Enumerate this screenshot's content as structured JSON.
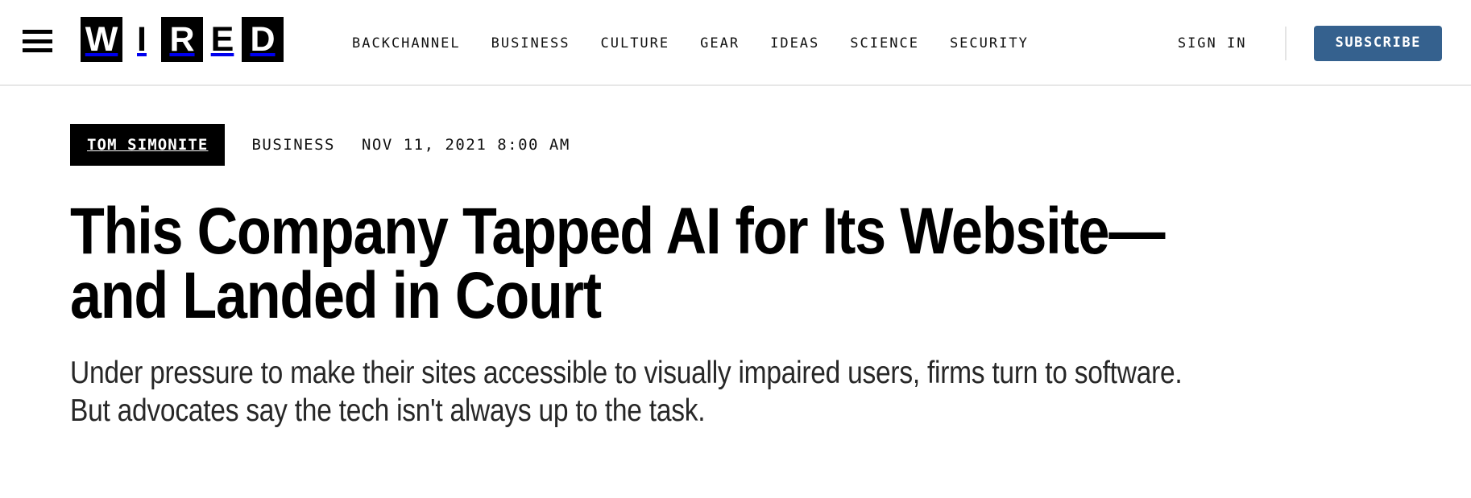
{
  "header": {
    "menu_icon": "hamburger-menu-icon",
    "logo": {
      "name": "WIRED",
      "letters": [
        {
          "char": "W",
          "inverted": true
        },
        {
          "char": "I",
          "inverted": false
        },
        {
          "char": "R",
          "inverted": true
        },
        {
          "char": "E",
          "inverted": false
        },
        {
          "char": "D",
          "inverted": true
        }
      ]
    },
    "nav_links": [
      {
        "label": "BACKCHANNEL"
      },
      {
        "label": "BUSINESS"
      },
      {
        "label": "CULTURE"
      },
      {
        "label": "GEAR"
      },
      {
        "label": "IDEAS"
      },
      {
        "label": "SCIENCE"
      },
      {
        "label": "SECURITY"
      }
    ],
    "sign_in_label": "SIGN IN",
    "subscribe_label": "SUBSCRIBE",
    "subscribe_color": "#35618e",
    "divider_color": "#e4e4e4",
    "border_color": "#e7e7e7"
  },
  "article": {
    "author": "TOM SIMONITE",
    "category": "BUSINESS",
    "date": "NOV 11, 2021 8:00 AM",
    "headline": "This Company Tapped AI for Its Website—and Landed in Court",
    "deck": "Under pressure to make their sites accessible to visually impaired users, firms turn to software. But advocates say the tech isn't always up to the task."
  }
}
